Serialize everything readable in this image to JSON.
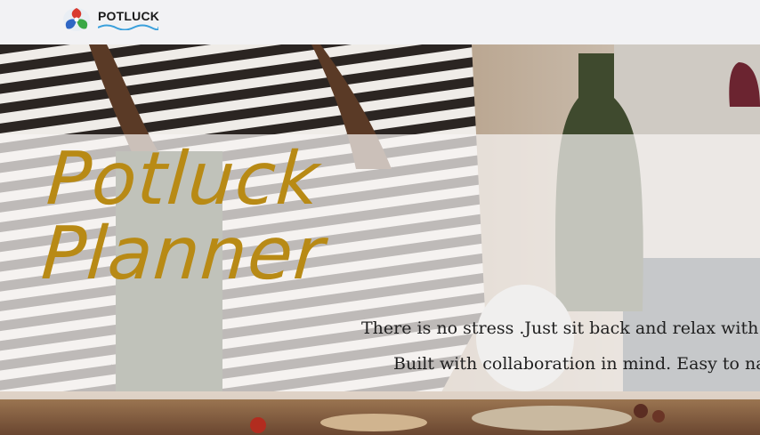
{
  "header": {
    "logo_text": "POTLUCK",
    "logo_icon": "potluck-logo-icon"
  },
  "hero": {
    "title_line1": "Potluck",
    "title_line2": "Planner",
    "tagline_1": "There is no stress .Just sit back and relax with t",
    "tagline_2": "Built with collaboration in mind. Easy to na"
  },
  "colors": {
    "title": "#b88a15",
    "navbar_bg": "#f2f2f4",
    "band_bg": "rgba(246,244,242,0.72)"
  }
}
